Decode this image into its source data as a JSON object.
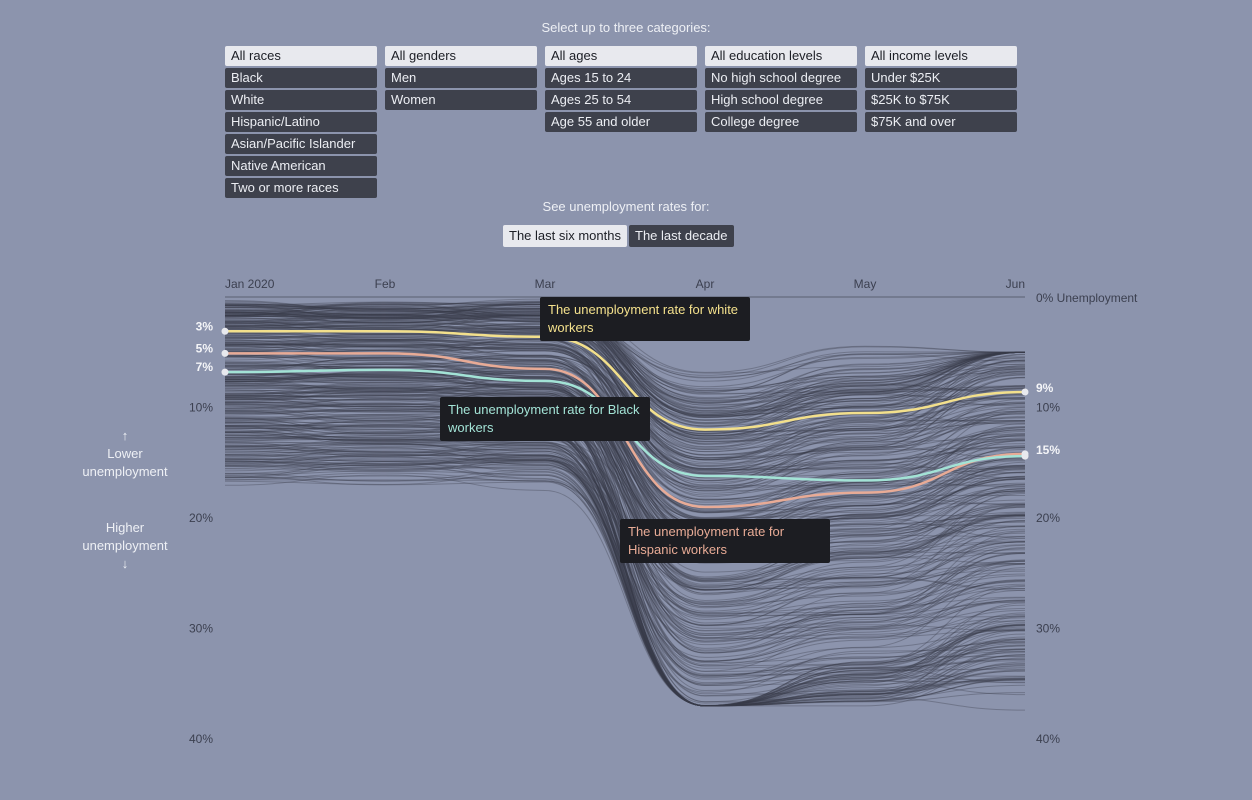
{
  "controls": {
    "select_prompt": "Select up to three categories:",
    "groups": [
      {
        "name": "race",
        "options": [
          {
            "label": "All races",
            "selected": true
          },
          {
            "label": "Black",
            "selected": false
          },
          {
            "label": "White",
            "selected": false
          },
          {
            "label": "Hispanic/Latino",
            "selected": false
          },
          {
            "label": "Asian/Pacific Islander",
            "selected": false
          },
          {
            "label": "Native American",
            "selected": false
          },
          {
            "label": "Two or more races",
            "selected": false
          }
        ]
      },
      {
        "name": "gender",
        "options": [
          {
            "label": "All genders",
            "selected": true
          },
          {
            "label": "Men",
            "selected": false
          },
          {
            "label": "Women",
            "selected": false
          }
        ]
      },
      {
        "name": "age",
        "options": [
          {
            "label": "All ages",
            "selected": true
          },
          {
            "label": "Ages 15 to 24",
            "selected": false
          },
          {
            "label": "Ages 25 to 54",
            "selected": false
          },
          {
            "label": "Age 55 and older",
            "selected": false
          }
        ]
      },
      {
        "name": "education",
        "options": [
          {
            "label": "All education levels",
            "selected": true
          },
          {
            "label": "No high school degree",
            "selected": false
          },
          {
            "label": "High school degree",
            "selected": false
          },
          {
            "label": "College degree",
            "selected": false
          }
        ]
      },
      {
        "name": "income",
        "options": [
          {
            "label": "All income levels",
            "selected": true
          },
          {
            "label": "Under $25K",
            "selected": false
          },
          {
            "label": "$25K to $75K",
            "selected": false
          },
          {
            "label": "$75K and over",
            "selected": false
          }
        ]
      }
    ],
    "range_prompt": "See unemployment rates for:",
    "range_options": [
      {
        "label": "The last six months",
        "selected": true
      },
      {
        "label": "The last decade",
        "selected": false
      }
    ]
  },
  "side_notes": {
    "lower": "Lower unemployment",
    "higher": "Higher unemployment",
    "up_arrow": "↑",
    "down_arrow": "↓"
  },
  "chart_data": {
    "type": "line",
    "x": [
      "Jan 2020",
      "Feb",
      "Mar",
      "Apr",
      "May",
      "Jun"
    ],
    "ylabel_top": "0% Unemployment",
    "y_ticks": [
      "10%",
      "20%",
      "30%",
      "40%"
    ],
    "ylim": [
      0,
      40
    ],
    "y_inverted": true,
    "colors": {
      "white": "#f3e08c",
      "black": "#a3e3d6",
      "hispanic": "#e8ab96",
      "background_lines": "#3a3d4a"
    },
    "series": [
      {
        "name": "White workers",
        "key": "white",
        "values": [
          3.1,
          3.1,
          3.6,
          12.0,
          10.5,
          8.6
        ],
        "start_label": "3%",
        "end_label": "9%"
      },
      {
        "name": "Hispanic workers",
        "key": "hispanic",
        "values": [
          5.1,
          5.1,
          6.5,
          19.0,
          17.7,
          14.2
        ],
        "start_label": "5%",
        "end_label": "15%"
      },
      {
        "name": "Black workers",
        "key": "black",
        "values": [
          6.8,
          6.6,
          7.6,
          16.2,
          16.6,
          14.4
        ],
        "start_label": "7%",
        "end_label": ""
      }
    ],
    "background_series_note": "hundreds of thin grey lines for other demographic combinations (approx. 1-14% in Jan-Mar, 6-37% in Apr-Jun)",
    "annotations": [
      {
        "series": "white",
        "text": "The unemployment rate for white workers"
      },
      {
        "series": "black",
        "text": "The unemployment rate for Black workers"
      },
      {
        "series": "hispanic",
        "text": "The unemployment rate for Hispanic workers"
      }
    ]
  }
}
